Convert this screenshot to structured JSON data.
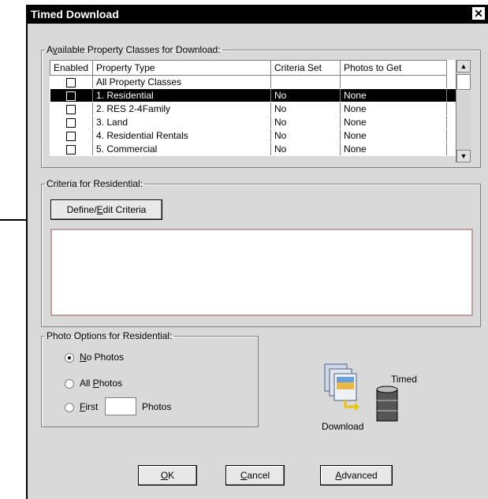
{
  "window": {
    "title": "Timed Download",
    "close_label": "✕"
  },
  "available": {
    "legend_pre": "A",
    "legend_u": "v",
    "legend_post": "ailable Property Classes for Download:",
    "columns": [
      "Enabled",
      "Property Type",
      "Criteria Set",
      "Photos to Get"
    ],
    "rows": [
      {
        "type": "All Property Classes",
        "criteria": "",
        "photos": ""
      },
      {
        "type": "1. Residential",
        "criteria": "No",
        "photos": "None"
      },
      {
        "type": "2. RES 2-4Family",
        "criteria": "No",
        "photos": "None"
      },
      {
        "type": "3. Land",
        "criteria": "No",
        "photos": "None"
      },
      {
        "type": "4. Residential Rentals",
        "criteria": "No",
        "photos": "None"
      },
      {
        "type": "5. Commercial",
        "criteria": "No",
        "photos": "None"
      }
    ],
    "selected_row": 1
  },
  "criteria": {
    "legend": "Criteria for Residential:",
    "define_pre": "Define/",
    "define_u": "E",
    "define_post": "dit Criteria"
  },
  "photo_options": {
    "legend": "Photo Options for Residential:",
    "no_photos_u": "N",
    "no_photos_rest": "o Photos",
    "all_photos_pre": "All ",
    "all_photos_u": "P",
    "all_photos_rest": "hotos",
    "first_u": "F",
    "first_rest": "irst",
    "photos_suffix": "Photos",
    "selected": "no_photos"
  },
  "logo": {
    "timed": "Timed",
    "download": "Download"
  },
  "buttons": {
    "ok_u": "O",
    "ok_rest": "K",
    "cancel_u": "C",
    "cancel_rest": "ancel",
    "advanced_u": "A",
    "advanced_rest": "dvanced"
  },
  "colors": {
    "title_bar": "#000000",
    "selection": "#000000",
    "dialog": "#d9d9d9"
  }
}
